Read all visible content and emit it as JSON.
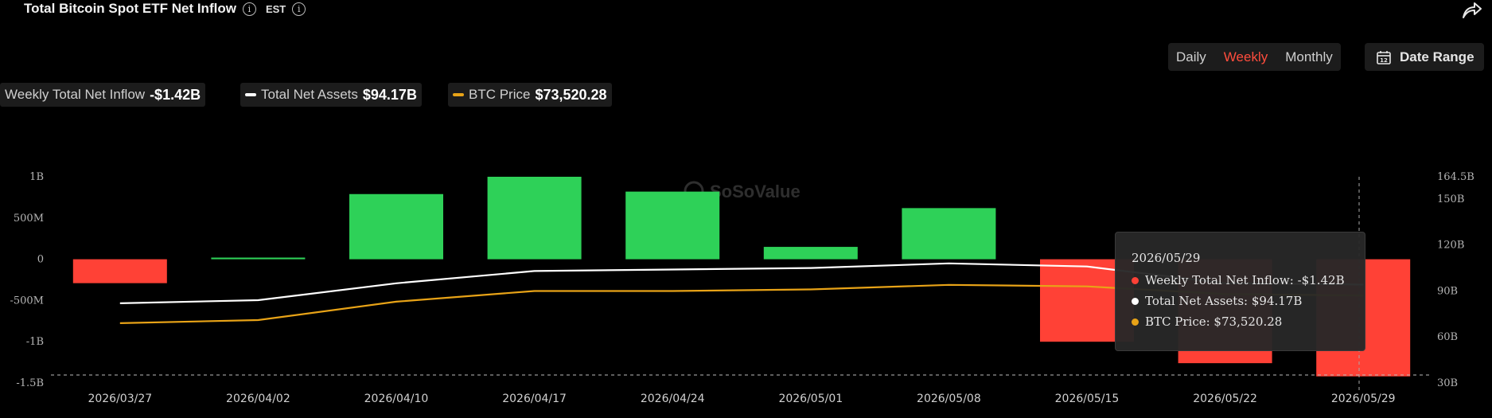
{
  "header": {
    "title": "Total Bitcoin Spot ETF Net Inflow",
    "timezone": "EST",
    "info_glyph": "i"
  },
  "controls": {
    "ranges": [
      "Daily",
      "Weekly",
      "Monthly"
    ],
    "active_range": "Weekly",
    "date_range_label": "Date Range",
    "calendar_day": "12"
  },
  "legend": {
    "inflow_label": "Weekly Total Net Inflow",
    "inflow_value": "-$1.42B",
    "assets_label": "Total Net Assets",
    "assets_value": "$94.17B",
    "btc_label": "BTC Price",
    "btc_value": "$73,520.28"
  },
  "watermark": "SoSoValue",
  "tooltip": {
    "date": "2026/05/29",
    "rows": [
      {
        "text": "Weekly Total Net Inflow: -$1.42B",
        "color": "#ff4136"
      },
      {
        "text": "Total Net Assets: $94.17B",
        "color": "#ffffff"
      },
      {
        "text": "BTC Price: $73,520.28",
        "color": "#e8a317"
      }
    ]
  },
  "colors": {
    "positive": "#2ed158",
    "negative": "#ff4136",
    "assets_line": "#ffffff",
    "btc_line": "#e8a317",
    "accent": "#ff4d3d"
  },
  "chart_data": {
    "type": "bar",
    "title": "Total Bitcoin Spot ETF Net Inflow",
    "categories": [
      "2026/03/27",
      "2026/04/02",
      "2026/04/10",
      "2026/04/17",
      "2026/04/24",
      "2026/05/01",
      "2026/05/08",
      "2026/05/15",
      "2026/05/22",
      "2026/05/29"
    ],
    "series": [
      {
        "name": "Weekly Total Net Inflow",
        "type": "bar",
        "axis": "left",
        "unit": "B",
        "values": [
          -0.29,
          0.02,
          0.79,
          1.0,
          0.82,
          0.15,
          0.62,
          -1.0,
          -1.26,
          -1.42
        ]
      },
      {
        "name": "Total Net Assets",
        "type": "line",
        "axis": "right",
        "unit": "B",
        "values": [
          82,
          84,
          95,
          103,
          104,
          105,
          108,
          106,
          95,
          94.17
        ]
      },
      {
        "name": "BTC Price",
        "type": "line",
        "axis": "right",
        "values": [
          69,
          71,
          83,
          90,
          90,
          91,
          94,
          93,
          88,
          87
        ]
      }
    ],
    "left_axis": {
      "ticks": [
        1,
        0.5,
        0,
        -0.5,
        -1,
        -1.5
      ],
      "tick_labels": [
        "1B",
        "500M",
        "0",
        "-500M",
        "-1B",
        "-1.5B"
      ],
      "ylim": [
        -1.5,
        1.0
      ]
    },
    "right_axis": {
      "ticks": [
        164.5,
        150,
        120,
        90,
        60,
        30
      ],
      "tick_labels": [
        "164.5B",
        "150B",
        "120B",
        "90B",
        "60B",
        "30B"
      ],
      "ylim": [
        30,
        164.5
      ]
    },
    "grid": false,
    "legend": "top-left"
  }
}
